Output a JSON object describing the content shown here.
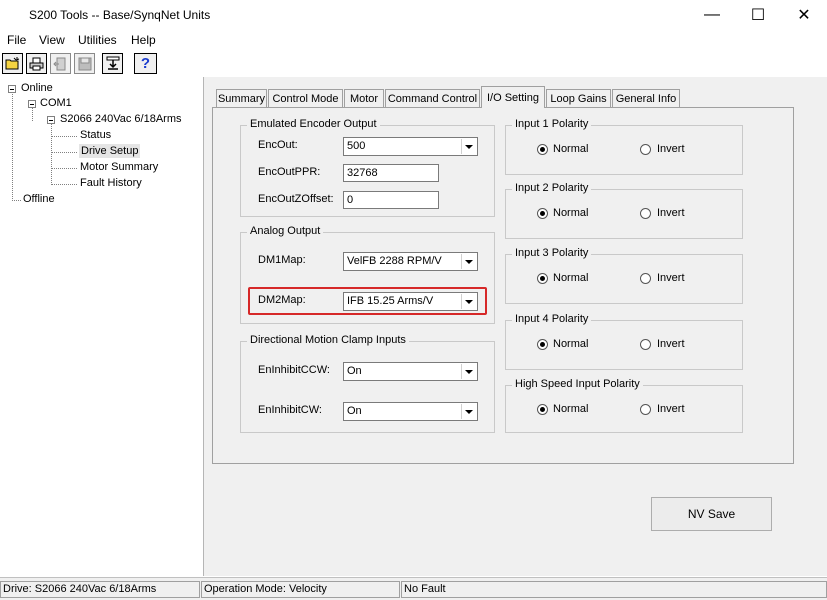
{
  "window": {
    "title": "S200 Tools -- Base/SynqNet Units",
    "minimize": "—",
    "maximize": "☐",
    "close": "✕"
  },
  "menu": {
    "items": [
      "File",
      "View",
      "Utilities",
      "Help"
    ]
  },
  "toolbar": {
    "buttons": [
      "open-folder-icon",
      "printer-icon",
      "door-icon",
      "save-disk-icon",
      "download-icon",
      "help-question-icon"
    ],
    "help_label": "?"
  },
  "tree": {
    "online": "Online",
    "com1": "COM1",
    "drive": "S2066 240Vac 6/18Arms",
    "status": "Status",
    "drive_setup": "Drive Setup",
    "motor_summary": "Motor Summary",
    "fault_history": "Fault History",
    "offline": "Offline",
    "selected": "Drive Setup"
  },
  "tabs": {
    "items": [
      "Summary",
      "Control Mode",
      "Motor",
      "Command Control",
      "I/O Setting",
      "Loop Gains",
      "General Info"
    ],
    "active": "I/O Setting"
  },
  "encoder": {
    "title": "Emulated Encoder Output",
    "encout_label": "EncOut:",
    "encout_value": "500",
    "ppr_label": "EncOutPPR:",
    "ppr_value": "32768",
    "zoffset_label": "EncOutZOffset:",
    "zoffset_value": "0"
  },
  "analog": {
    "title": "Analog Output",
    "dm1_label": "DM1Map:",
    "dm1_value": "VelFB 2288 RPM/V",
    "dm2_label": "DM2Map:",
    "dm2_value": "IFB 15.25 Arms/V"
  },
  "clamp": {
    "title": "Directional Motion Clamp Inputs",
    "ccw_label": "EnInhibitCCW:",
    "ccw_value": "On",
    "cw_label": "EnInhibitCW:",
    "cw_value": "On"
  },
  "polarity": {
    "normal_label": "Normal",
    "invert_label": "Invert",
    "groups": [
      {
        "title": "Input 1 Polarity",
        "selected": "Normal"
      },
      {
        "title": "Input 2 Polarity",
        "selected": "Normal"
      },
      {
        "title": "Input 3 Polarity",
        "selected": "Normal"
      },
      {
        "title": "Input 4 Polarity",
        "selected": "Normal"
      },
      {
        "title": "High Speed Input Polarity",
        "selected": "Normal"
      }
    ]
  },
  "nv_save": "NV Save",
  "status": {
    "drive": "Drive: S2066 240Vac 6/18Arms",
    "mode": "Operation Mode: Velocity",
    "fault": "No Fault"
  },
  "colors": {
    "highlight": "#d62828",
    "panel_bg": "#f0f0f0",
    "help_icon": "#1a3ccf"
  }
}
